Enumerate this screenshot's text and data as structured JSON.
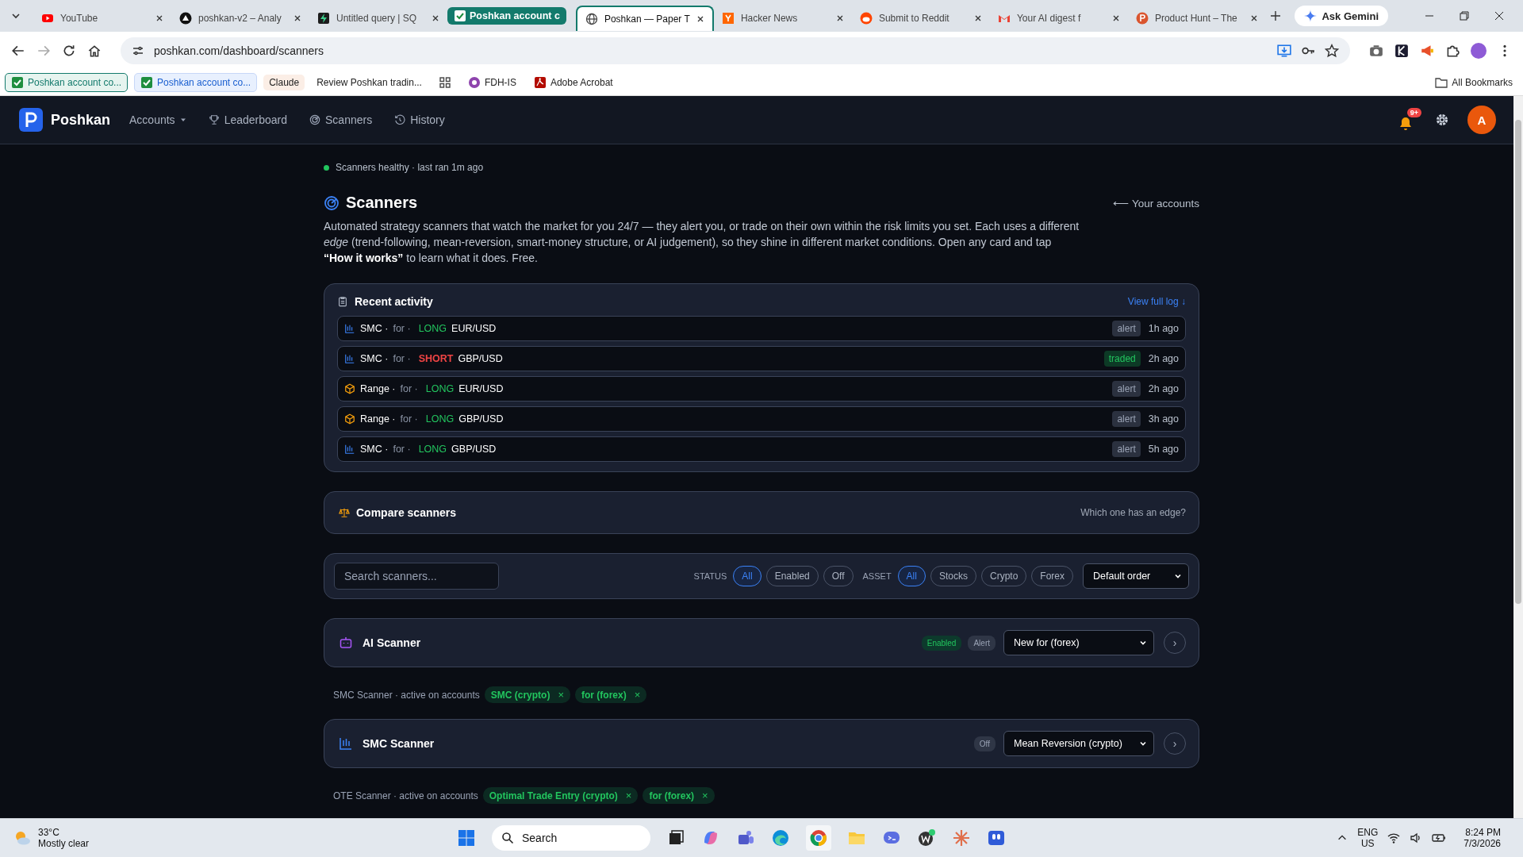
{
  "browser": {
    "tabs": [
      {
        "kind": "tab",
        "title": "YouTube",
        "selected": false
      },
      {
        "kind": "tab",
        "title": "poshkan-v2 – Analy",
        "selected": false
      },
      {
        "kind": "tab",
        "title": "Untitled query | SQ",
        "selected": false
      },
      {
        "kind": "group",
        "title": "Poshkan account c"
      },
      {
        "kind": "tab",
        "title": "Poshkan — Paper T",
        "selected": true
      },
      {
        "kind": "tab",
        "title": "Hacker News",
        "selected": false
      },
      {
        "kind": "tab",
        "title": "Submit to Reddit",
        "selected": false
      },
      {
        "kind": "tab",
        "title": "Your AI digest f",
        "selected": false
      },
      {
        "kind": "tab",
        "title": "Product Hunt – The",
        "selected": false
      }
    ],
    "gemini": "Ask Gemini",
    "url": "poshkan.com/dashboard/scanners",
    "bookmarks": [
      {
        "kind": "group",
        "title": "Poshkan account co..."
      },
      {
        "kind": "group",
        "title": "Poshkan account co..."
      },
      {
        "kind": "plain",
        "title": "Claude"
      },
      {
        "kind": "plain",
        "title": "Review Poshkan tradin..."
      },
      {
        "kind": "grid"
      },
      {
        "kind": "site",
        "title": "FDH-IS"
      },
      {
        "kind": "pdf",
        "title": "Adobe Acrobat"
      }
    ],
    "all_bookmarks": "All Bookmarks"
  },
  "header": {
    "brand": "Poshkan",
    "nav": [
      {
        "kind": "menu",
        "label": "Accounts"
      },
      {
        "kind": "trophy",
        "label": "Leaderboard"
      },
      {
        "kind": "radar",
        "label": "Scanners"
      },
      {
        "kind": "history",
        "label": "History"
      }
    ],
    "notifications": "9+",
    "avatar": "A"
  },
  "status": "Scanners healthy · last ran 1m ago",
  "title": "Scanners",
  "back_link": "⟵ Your accounts",
  "description": "Automated strategy scanners that watch the market for you 24/7 — they alert you, or trade on their own within the risk limits you set. Each uses a different *edge* (trend-following, mean-reversion, smart-money structure, or AI judgement), so they shine in different market conditions. Open any card and tap **“How it works”** to learn what it does. Free.",
  "recent_activity": {
    "title": "Recent activity",
    "link": "View full log ↓",
    "rows": [
      {
        "kind": "smc",
        "name": "SMC ·",
        "for": "for ·",
        "side": "LONG",
        "long": true,
        "pair": "EUR/USD",
        "status": "alert",
        "traded": false,
        "time": "1h ago"
      },
      {
        "kind": "smc",
        "name": "SMC ·",
        "for": "for ·",
        "side": "SHORT",
        "long": false,
        "pair": "GBP/USD",
        "status": "traded",
        "traded": true,
        "time": "2h ago"
      },
      {
        "kind": "range",
        "name": "Range ·",
        "for": "for ·",
        "side": "LONG",
        "long": true,
        "pair": "EUR/USD",
        "status": "alert",
        "traded": false,
        "time": "2h ago"
      },
      {
        "kind": "range",
        "name": "Range ·",
        "for": "for ·",
        "side": "LONG",
        "long": true,
        "pair": "GBP/USD",
        "status": "alert",
        "traded": false,
        "time": "3h ago"
      },
      {
        "kind": "smc",
        "name": "SMC ·",
        "for": "for ·",
        "side": "LONG",
        "long": true,
        "pair": "GBP/USD",
        "status": "alert",
        "traded": false,
        "time": "5h ago"
      }
    ]
  },
  "compare": {
    "title": "Compare scanners",
    "hint": "Which one has an edge?"
  },
  "filters": {
    "search_placeholder": "Search scanners...",
    "status_label": "STATUS",
    "status_options": [
      {
        "label": "All",
        "selected": true
      },
      {
        "label": "Enabled",
        "selected": false
      },
      {
        "label": "Off",
        "selected": false
      }
    ],
    "asset_label": "ASSET",
    "asset_options": [
      {
        "label": "All",
        "selected": true
      },
      {
        "label": "Stocks",
        "selected": false
      },
      {
        "label": "Crypto",
        "selected": false
      },
      {
        "label": "Forex",
        "selected": false
      }
    ],
    "sort": "Default order"
  },
  "scanners": [
    {
      "kind": "ai",
      "name": "AI Scanner",
      "badges": [
        {
          "label": "Enabled",
          "kind": "enabled"
        },
        {
          "label": "Alert",
          "kind": "mode"
        }
      ],
      "strategy": "New for (forex)",
      "open": "›"
    },
    {
      "kind": "accounts",
      "label": "SMC Scanner · active on accounts",
      "chips": [
        "SMC (crypto)",
        "for (forex)"
      ],
      "remove": "×"
    },
    {
      "kind": "smc",
      "name": "SMC Scanner",
      "badges": [
        {
          "label": "Off",
          "kind": "off"
        }
      ],
      "strategy": "Mean Reversion (crypto)",
      "open": "›"
    },
    {
      "kind": "accounts",
      "label": "OTE Scanner · active on accounts",
      "chips": [
        "Optimal Trade Entry (crypto)",
        "for (forex)"
      ],
      "remove": "×"
    }
  ],
  "taskbar": {
    "temperature": "33°C",
    "weather": "Mostly clear",
    "search": "Search",
    "language": "ENG",
    "region": "US",
    "time": "8:24 PM",
    "date": "7/3/2026"
  }
}
